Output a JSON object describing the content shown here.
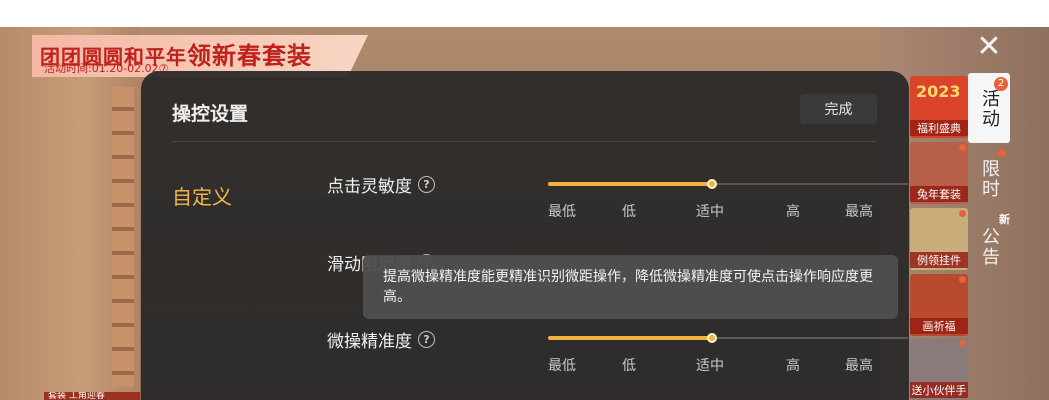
{
  "banner": {
    "title_prefix": "团团圆圆和平年",
    "title_main": "领新春套装",
    "subtitle": "活动时间:01.20-02.02⑦"
  },
  "panel": {
    "title": "操控设置",
    "done_label": "完成",
    "tab_label": "自定义"
  },
  "settings": [
    {
      "label": "点击灵敏度",
      "value": 0.45,
      "ticks": [
        "最低",
        "低",
        "适中",
        "高",
        "最高"
      ]
    },
    {
      "label": "滑动阻尼感",
      "ticks": []
    },
    {
      "label": "微操精准度",
      "value": 0.45,
      "ticks": [
        "最低",
        "低",
        "适中",
        "高",
        "最高"
      ]
    }
  ],
  "tooltip": {
    "text": "提高微操精准度能更精准识别微距操作，降低微操精准度可使点击操作响应度更高。"
  },
  "side_tabs": [
    {
      "label": "活动",
      "badge": "2",
      "active": true
    },
    {
      "label": "限时",
      "badge": "",
      "active": false
    },
    {
      "label": "公告",
      "badge": "新",
      "active": false
    }
  ],
  "thumbs": [
    {
      "caption": "福利盛典",
      "top_text": "2023",
      "color": "#d9442b"
    },
    {
      "caption": "兔年套装",
      "top_text": "",
      "color": "#b85f4a"
    },
    {
      "caption": "例领挂件",
      "top_text": "",
      "color": "#c9ad7a"
    },
    {
      "caption": "画祈福",
      "top_text": "",
      "color": "#b94a2e"
    },
    {
      "caption": "送小伙伴手",
      "top_text": "",
      "color": "#8a7b7a"
    }
  ],
  "close_icon": "close-icon",
  "help_icon": "help-circle-icon",
  "bottom_tag": "套装 工角迎春"
}
